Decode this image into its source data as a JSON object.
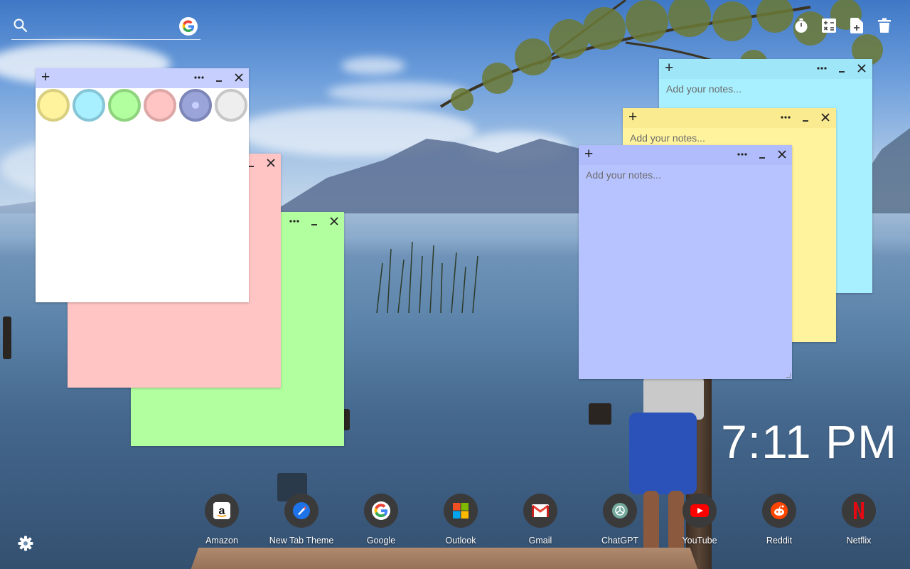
{
  "search": {
    "placeholder": "",
    "value": "",
    "engine_icon": "google-icon"
  },
  "tools": [
    {
      "name": "timer-icon"
    },
    {
      "name": "calculator-icon"
    },
    {
      "name": "new-note-icon"
    },
    {
      "name": "trash-icon"
    }
  ],
  "notes": {
    "placeholder": "Add your notes...",
    "cyan": {
      "color": "#a8f0ff",
      "bar": "#9ee6f8"
    },
    "yellow": {
      "color": "#fff39e",
      "bar": "#fbeb90"
    },
    "blue": {
      "color": "#b7c3ff",
      "bar": "#b0bcfb"
    },
    "pink": {
      "color": "#ffc4c4"
    },
    "green": {
      "color": "#b1ff9e"
    },
    "white": {
      "color": "#ffffff",
      "bar": "#c7cfff"
    }
  },
  "swatch_colors": [
    {
      "name": "yellow",
      "fill": "#fff39e",
      "ring": "#d9cf80"
    },
    {
      "name": "cyan",
      "fill": "#a8f0ff",
      "ring": "#86c6d6"
    },
    {
      "name": "green",
      "fill": "#b1ff9e",
      "ring": "#8ed37d"
    },
    {
      "name": "pink",
      "fill": "#ffc4c4",
      "ring": "#dea7a7"
    },
    {
      "name": "blue",
      "fill": "#9aa4d8",
      "ring": "#7d86b8"
    },
    {
      "name": "gray",
      "fill": "#eeeeee",
      "ring": "#c7c7c7"
    }
  ],
  "clock": {
    "time": "7:11 PM"
  },
  "dock": [
    {
      "label": "Amazon",
      "icon": "amazon-icon"
    },
    {
      "label": "New Tab Theme",
      "icon": "new-tab-theme-icon"
    },
    {
      "label": "Google",
      "icon": "google-icon"
    },
    {
      "label": "Outlook",
      "icon": "outlook-icon"
    },
    {
      "label": "Gmail",
      "icon": "gmail-icon"
    },
    {
      "label": "ChatGPT",
      "icon": "chatgpt-icon"
    },
    {
      "label": "YouTube",
      "icon": "youtube-icon"
    },
    {
      "label": "Reddit",
      "icon": "reddit-icon"
    },
    {
      "label": "Netflix",
      "icon": "netflix-icon"
    }
  ],
  "settings": {
    "icon": "gear-icon"
  }
}
